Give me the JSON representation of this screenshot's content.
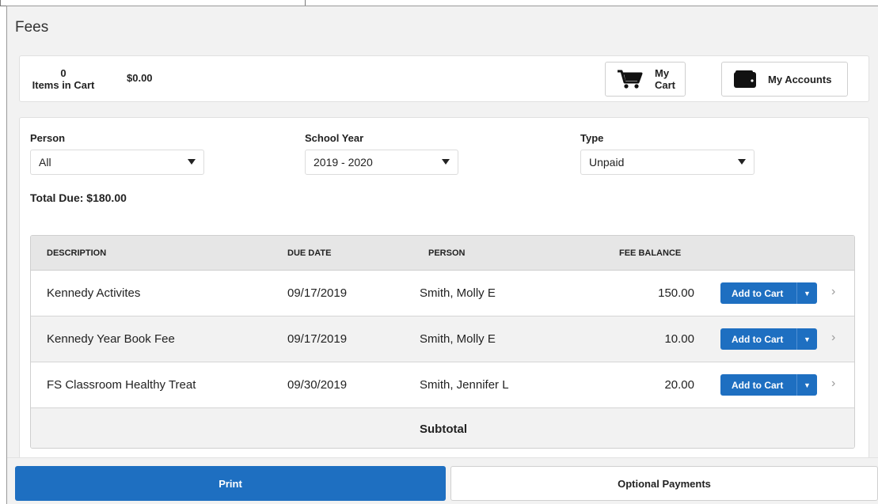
{
  "page": {
    "title": "Fees"
  },
  "cart": {
    "count": "0",
    "count_label": "Items in Cart",
    "total": "$0.00",
    "my_cart_label": "My Cart",
    "my_accounts_label": "My Accounts"
  },
  "filters": {
    "person": {
      "label": "Person",
      "value": "All"
    },
    "school_year": {
      "label": "School Year",
      "value": "2019 - 2020"
    },
    "type": {
      "label": "Type",
      "value": "Unpaid"
    }
  },
  "total_due": "Total Due: $180.00",
  "table": {
    "headers": [
      "DESCRIPTION",
      "DUE DATE",
      "PERSON",
      "FEE BALANCE"
    ],
    "rows": [
      {
        "description": "Kennedy Activites",
        "due_date": "09/17/2019",
        "person": "Smith, Molly E",
        "balance": "150.00",
        "action": "Add to Cart"
      },
      {
        "description": "Kennedy Year Book Fee",
        "due_date": "09/17/2019",
        "person": "Smith, Molly E",
        "balance": "10.00",
        "action": "Add to Cart"
      },
      {
        "description": "FS Classroom Healthy Treat",
        "due_date": "09/30/2019",
        "person": "Smith, Jennifer L",
        "balance": "20.00",
        "action": "Add to Cart"
      }
    ],
    "subtotal_label": "Subtotal"
  },
  "footer": {
    "print_label": "Print",
    "optional_label": "Optional Payments"
  },
  "colors": {
    "primary": "#1e6fc1",
    "background": "#f2f2f2",
    "header_row": "#e6e6e6"
  },
  "icons": {
    "cart": "cart-icon",
    "wallet": "wallet-icon",
    "dropdown": "caret-down-icon",
    "row_nav": "chevron-right-icon"
  }
}
